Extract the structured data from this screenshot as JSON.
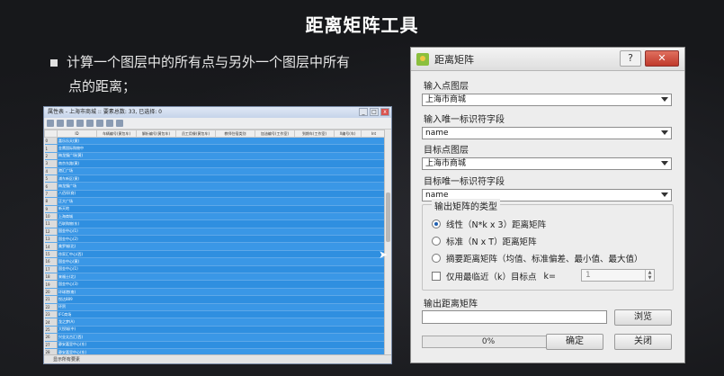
{
  "slide": {
    "title": "距离矩阵工具",
    "bullet_line1": "计算一个图层中的所有点与另外一个图层中所有",
    "bullet_line2": "点的距离；"
  },
  "attribute_table": {
    "window_title": "属性表 - 上海市商城 :: 要素总数: 33, 已选择: 0",
    "headers": [
      "ID",
      "车辆编号(黄包车)",
      "解析编号(黄包车)",
      "员工用餐(黄包车)",
      "教师住宿类别",
      "加油编号(工作室)",
      "到期车(工作室)",
      "X编号(车)",
      "Int"
    ],
    "rows": [
      {
        "n": "0",
        "name": "喜乐乐天(黄)"
      },
      {
        "n": "1",
        "name": "金鹰国际购物中"
      },
      {
        "n": "2",
        "name": "梅龙镇广场(黄)"
      },
      {
        "n": "3",
        "name": "南京东路(黄)"
      },
      {
        "n": "4",
        "name": "港汇广场"
      },
      {
        "n": "5",
        "name": "浦东新区(黄)"
      },
      {
        "n": "6",
        "name": "梅龙镇广场"
      },
      {
        "n": "7",
        "name": "八佰伴(商)"
      },
      {
        "n": "8",
        "name": "正大广场"
      },
      {
        "n": "9",
        "name": "新天地"
      },
      {
        "n": "10",
        "name": "上海商城"
      },
      {
        "n": "11",
        "name": "百联购物(东)"
      },
      {
        "n": "12",
        "name": "国金中心(1)"
      },
      {
        "n": "13",
        "name": "国金中心(2)"
      },
      {
        "n": "14",
        "name": "美罗城(北)"
      },
      {
        "n": "15",
        "name": "徐家汇中心(西)"
      },
      {
        "n": "16",
        "name": "国金中心(黄)"
      },
      {
        "n": "17",
        "name": "国金中心(1)"
      },
      {
        "n": "18",
        "name": "来福士(北)"
      },
      {
        "n": "19",
        "name": "国金中心(3)"
      },
      {
        "n": "20",
        "name": "环球港(南)"
      },
      {
        "n": "21",
        "name": "悦达889"
      },
      {
        "n": "22",
        "name": "环贸"
      },
      {
        "n": "23",
        "name": "IFC商场"
      },
      {
        "n": "24",
        "name": "龙之梦(A)"
      },
      {
        "n": "25",
        "name": "大悦城(中)"
      },
      {
        "n": "26",
        "name": "兴业太古汇(西)"
      },
      {
        "n": "27",
        "name": "静安嘉里中心(东)"
      },
      {
        "n": "28",
        "name": "静安嘉里中心(东)"
      },
      {
        "n": "29",
        "name": "晶品购物中心"
      },
      {
        "n": "30",
        "name": "久光百货"
      },
      {
        "n": "31",
        "name": "南方商城"
      },
      {
        "n": "32",
        "name": "国金中心(西)"
      }
    ],
    "status": "显示所有要素"
  },
  "dialog": {
    "title": "距离矩阵",
    "help_label": "?",
    "close_label": "✕",
    "input_layer_label": "输入点图层",
    "input_layer_value": "上海市商城",
    "input_id_label": "输入唯一标识符字段",
    "input_id_value": "name",
    "target_layer_label": "目标点图层",
    "target_layer_value": "上海市商城",
    "target_id_label": "目标唯一标识符字段",
    "target_id_value": "name",
    "matrix_type_label": "输出矩阵的类型",
    "opt_linear": "线性（N*k x 3）距离矩阵",
    "opt_standard": "标准（N x T）距离矩阵",
    "opt_summary": "摘要距离矩阵（均值、标准偏差、最小值、最大值）",
    "nearest_label": "仅用最临近（k）目标点",
    "k_label": "k=",
    "k_value": "1",
    "output_label": "输出距离矩阵",
    "browse_label": "浏览",
    "progress_text": "0%",
    "progress_fraction": 0,
    "ok_label": "确定",
    "close_button_label": "关闭"
  }
}
